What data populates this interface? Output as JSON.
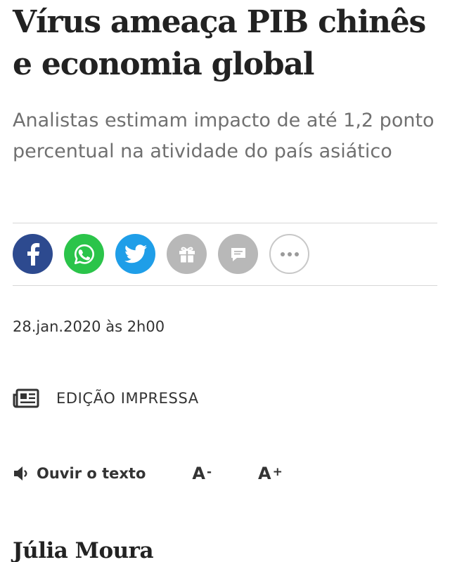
{
  "article": {
    "headline": "Vírus ameaça PIB chinês e economia global",
    "subtitle": "Analistas estimam impacto de até 1,2 ponto percentual na atividade do país asiático",
    "dateline": "28.jan.2020 às 2h00",
    "author": "Júlia Moura"
  },
  "share_bar": {
    "buttons": [
      {
        "name": "facebook",
        "icon": "facebook-icon",
        "color": "#2d4a8f"
      },
      {
        "name": "whatsapp",
        "icon": "whatsapp-icon",
        "color": "#2bc44a"
      },
      {
        "name": "twitter",
        "icon": "twitter-icon",
        "color": "#1f9ee8"
      },
      {
        "name": "gift",
        "icon": "gift-icon",
        "color": "#b8b8b8"
      },
      {
        "name": "comments",
        "icon": "comment-icon",
        "color": "#b8b8b8"
      },
      {
        "name": "more",
        "icon": "more-icon",
        "color": "#c8c8c8"
      }
    ]
  },
  "print_edition": {
    "icon": "newspaper-icon",
    "label": "EDIÇÃO IMPRESSA"
  },
  "audio_controls": {
    "listen_icon": "speaker-icon",
    "listen_label": "Ouvir o texto",
    "font_decrease_letter": "A",
    "font_decrease_sign": "-",
    "font_increase_letter": "A",
    "font_increase_sign": "+"
  }
}
